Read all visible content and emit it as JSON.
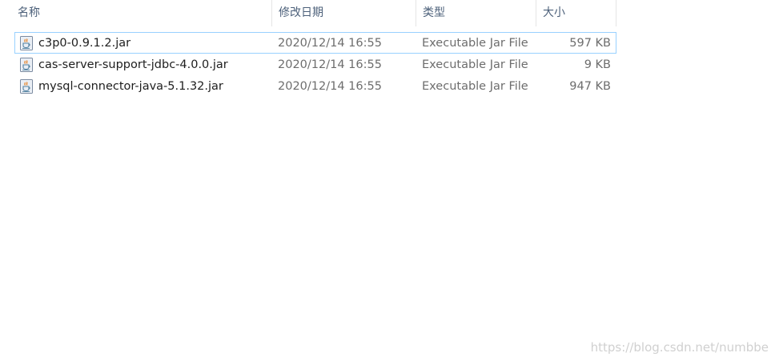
{
  "columns": {
    "name": "名称",
    "date": "修改日期",
    "type": "类型",
    "size": "大小",
    "sort_indicator": "^"
  },
  "files": [
    {
      "name": "c3p0-0.9.1.2.jar",
      "date": "2020/12/14 16:55",
      "type": "Executable Jar File",
      "size": "597 KB",
      "icon": "java-jar-icon",
      "focused": true
    },
    {
      "name": "cas-server-support-jdbc-4.0.0.jar",
      "date": "2020/12/14 16:55",
      "type": "Executable Jar File",
      "size": "9 KB",
      "icon": "java-jar-icon",
      "focused": false
    },
    {
      "name": "mysql-connector-java-5.1.32.jar",
      "date": "2020/12/14 16:55",
      "type": "Executable Jar File",
      "size": "947 KB",
      "icon": "java-jar-icon",
      "focused": false
    }
  ],
  "watermark": "https://blog.csdn.net/numbbe",
  "colors": {
    "header_text": "#4c607a",
    "focus_border": "#99d1ff",
    "detail_text": "#6d6d6d"
  }
}
